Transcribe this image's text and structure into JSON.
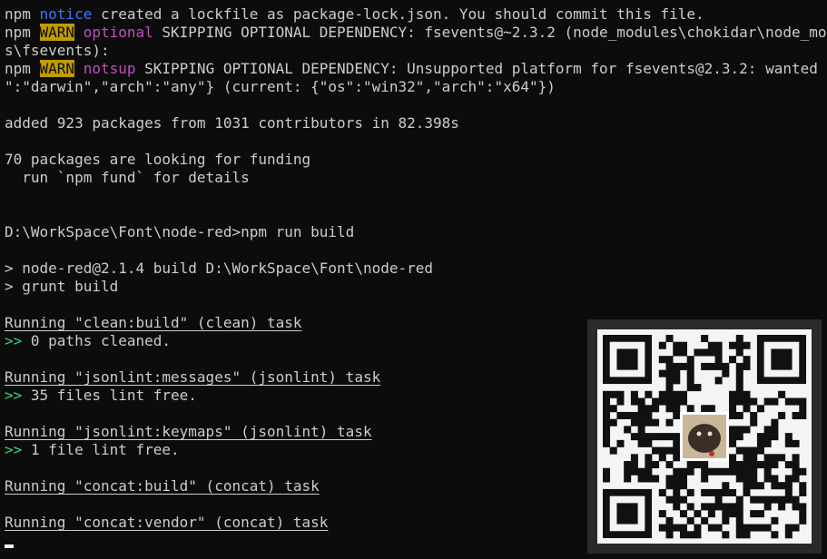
{
  "terminal": {
    "lines": [
      [
        {
          "t": "npm ",
          "c": "c-npm"
        },
        {
          "t": "notice",
          "c": "c-notice"
        },
        {
          "t": " created a lockfile as package-lock.json. You should commit this file.",
          "c": "c-npm"
        }
      ],
      [
        {
          "t": "npm ",
          "c": "c-npm"
        },
        {
          "t": "WARN",
          "c": "c-warn"
        },
        {
          "t": " ",
          "c": "c-npm"
        },
        {
          "t": "optional",
          "c": "c-mag"
        },
        {
          "t": " SKIPPING OPTIONAL DEPENDENCY: fsevents@~2.3.2 (node_modules\\chokidar\\node_module",
          "c": "c-npm"
        }
      ],
      [
        {
          "t": "s\\fsevents):",
          "c": "c-npm"
        }
      ],
      [
        {
          "t": "npm ",
          "c": "c-npm"
        },
        {
          "t": "WARN",
          "c": "c-warn"
        },
        {
          "t": " ",
          "c": "c-npm"
        },
        {
          "t": "notsup",
          "c": "c-mag"
        },
        {
          "t": " SKIPPING OPTIONAL DEPENDENCY: Unsupported platform for fsevents@2.3.2: wanted {\"os",
          "c": "c-npm"
        }
      ],
      [
        {
          "t": "\":\"darwin\",\"arch\":\"any\"} (current: {\"os\":\"win32\",\"arch\":\"x64\"})",
          "c": "c-npm"
        }
      ],
      [
        {
          "t": "",
          "c": "c-npm"
        }
      ],
      [
        {
          "t": "added 923 packages from 1031 contributors in 82.398s",
          "c": "c-npm"
        }
      ],
      [
        {
          "t": "",
          "c": "c-npm"
        }
      ],
      [
        {
          "t": "70 packages are looking for funding",
          "c": "c-npm"
        }
      ],
      [
        {
          "t": "  run `npm fund` for details",
          "c": "c-npm"
        }
      ],
      [
        {
          "t": "",
          "c": "c-npm"
        }
      ],
      [
        {
          "t": "",
          "c": "c-npm"
        }
      ],
      [
        {
          "t": "D:\\WorkSpace\\Font\\node-red>npm run build",
          "c": "c-npm"
        }
      ],
      [
        {
          "t": "",
          "c": "c-npm"
        }
      ],
      [
        {
          "t": "> node-red@2.1.4 build D:\\WorkSpace\\Font\\node-red",
          "c": "c-npm"
        }
      ],
      [
        {
          "t": "> grunt build",
          "c": "c-npm"
        }
      ],
      [
        {
          "t": "",
          "c": "c-npm"
        }
      ],
      [
        {
          "t": "Running \"clean:build\" (clean) task",
          "c": "c-npm c-ul"
        }
      ],
      [
        {
          "t": ">>",
          "c": "c-cyan"
        },
        {
          "t": " 0 paths cleaned.",
          "c": "c-npm"
        }
      ],
      [
        {
          "t": "",
          "c": "c-npm"
        }
      ],
      [
        {
          "t": "Running \"jsonlint:messages\" (jsonlint) task",
          "c": "c-npm c-ul"
        }
      ],
      [
        {
          "t": ">>",
          "c": "c-cyan"
        },
        {
          "t": " 35 files lint free.",
          "c": "c-npm"
        }
      ],
      [
        {
          "t": "",
          "c": "c-npm"
        }
      ],
      [
        {
          "t": "Running \"jsonlint:keymaps\" (jsonlint) task",
          "c": "c-npm c-ul"
        }
      ],
      [
        {
          "t": ">>",
          "c": "c-cyan"
        },
        {
          "t": " 1 file lint free.",
          "c": "c-npm"
        }
      ],
      [
        {
          "t": "",
          "c": "c-npm"
        }
      ],
      [
        {
          "t": "Running \"concat:build\" (concat) task",
          "c": "c-npm c-ul"
        }
      ],
      [
        {
          "t": "",
          "c": "c-npm"
        }
      ],
      [
        {
          "t": "Running \"concat:vendor\" (concat) task",
          "c": "c-npm c-ul"
        }
      ]
    ]
  },
  "overlay": {
    "icon": "qr-code-icon",
    "center_icon": "pug-avatar-icon"
  },
  "colors": {
    "background": "#0c0c0c",
    "text": "#cccccc",
    "notice": "#3b78ff",
    "warn_bg": "#c19c00",
    "tag": "#c050c0",
    "prompt_arrow": "#3ad27a"
  }
}
